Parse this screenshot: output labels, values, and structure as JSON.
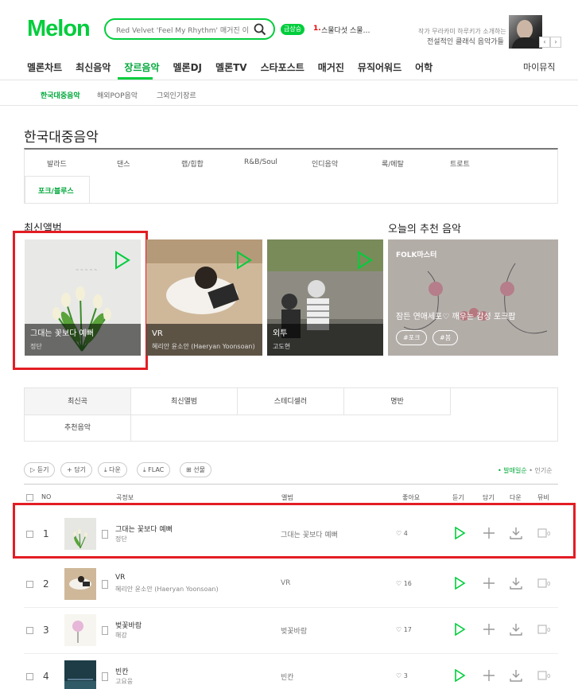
{
  "header": {
    "logo": "Melon",
    "search_placeholder": "Red Velvet 'Feel My Rhythm' 매거진 이벤트!",
    "rank_badge": "급상승",
    "rank_num": "1.",
    "rank_text": "스물다섯 스물…",
    "promo_line1": "작가 무라카미 하루키가 소개하는",
    "promo_line2": "전설적인 클래식 음악가들"
  },
  "gnb": {
    "items": [
      "멜론차트",
      "최신음악",
      "장르음악",
      "멜론DJ",
      "멜론TV",
      "스타포스트",
      "매거진",
      "뮤직어워드",
      "어학"
    ],
    "active": "장르음악",
    "mymusic": "마이뮤직"
  },
  "sub_nav": [
    "한국대중음악",
    "해외POP음악",
    "그외인기장르"
  ],
  "page_title": "한국대중음악",
  "genres": [
    "발라드",
    "댄스",
    "랩/힙합",
    "R&B/Soul",
    "인디음악",
    "록/메탈",
    "트로트",
    "포크/블루스"
  ],
  "latest_albums": {
    "title": "최신앨범",
    "items": [
      {
        "title": "그대는 꽃보다 예뻐",
        "artist": "정단"
      },
      {
        "title": "VR",
        "artist": "혜리안 윤소안 (Haeryan Yoonsoan)"
      },
      {
        "title": "외투",
        "artist": "고도현"
      }
    ]
  },
  "recommend": {
    "title": "오늘의 추천 음악",
    "dj": "FOLK마스터",
    "desc": "잠든 연애세포♡ 깨우는 감성 포크팝",
    "tags": [
      "#포크",
      "#봄"
    ]
  },
  "tabs": [
    "최신곡",
    "최신앨범",
    "스테디셀러",
    "명반",
    "추천음악"
  ],
  "actions": [
    "듣기",
    "담기",
    "다운",
    "FLAC",
    "선물"
  ],
  "sort": {
    "on": "발매일순",
    "off": "인기순"
  },
  "table_headers": {
    "no": "NO",
    "song": "곡정보",
    "album": "앨범",
    "like": "좋아요",
    "listen": "듣기",
    "add": "담기",
    "down": "다운",
    "mv": "뮤비"
  },
  "songs": [
    {
      "rank": "1",
      "title": "그대는 꽃보다 예뻐",
      "artist": "정단",
      "album": "그대는 꽃보다 예뻐",
      "likes": "4",
      "mv": "0"
    },
    {
      "rank": "2",
      "title": "VR",
      "artist": "혜리안 윤소안 (Haeryan Yoonsoan)",
      "album": "VR",
      "likes": "16",
      "mv": "0"
    },
    {
      "rank": "3",
      "title": "벚꽃바람",
      "artist": "해강",
      "album": "벚꽃바람",
      "likes": "17",
      "mv": "0"
    },
    {
      "rank": "4",
      "title": "빈칸",
      "artist": "고요웅",
      "album": "빈칸",
      "likes": "3",
      "mv": "0"
    }
  ],
  "colors": {
    "accent": "#00cd3c",
    "highlight": "#e31d24"
  }
}
